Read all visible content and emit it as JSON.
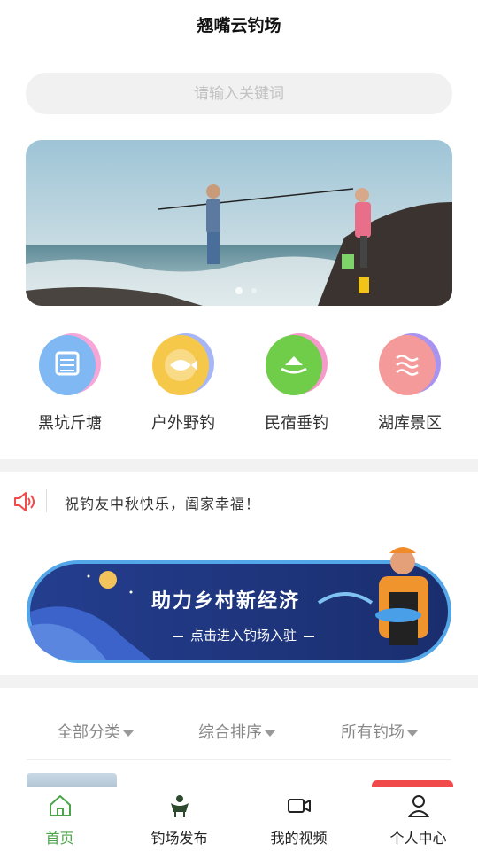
{
  "header": {
    "title": "翘嘴云钓场"
  },
  "search": {
    "placeholder": "请输入关键词"
  },
  "categories": [
    {
      "label": "黑坑斤塘",
      "icon": "pond-icon"
    },
    {
      "label": "户外野钓",
      "icon": "fish-icon"
    },
    {
      "label": "民宿垂钓",
      "icon": "boat-icon"
    },
    {
      "label": "湖库景区",
      "icon": "waves-icon"
    }
  ],
  "notice": {
    "text": "祝钓友中秋快乐，阖家幸福！"
  },
  "promo": {
    "title": "助力乡村新经济",
    "subtitle": "点击进入钓场入驻"
  },
  "filters": [
    {
      "label": "全部分类"
    },
    {
      "label": "综合排序"
    },
    {
      "label": "所有钓场"
    }
  ],
  "tabbar": [
    {
      "label": "首页",
      "icon": "home-icon",
      "active": true
    },
    {
      "label": "钓场发布",
      "icon": "fisherman-icon",
      "active": false
    },
    {
      "label": "我的视频",
      "icon": "video-camera-icon",
      "active": false
    },
    {
      "label": "个人中心",
      "icon": "user-icon",
      "active": false
    }
  ],
  "colors": {
    "accent": "#4aa54a",
    "notice_icon": "#f04a4a",
    "promo_bg": "#1f3b8a"
  }
}
